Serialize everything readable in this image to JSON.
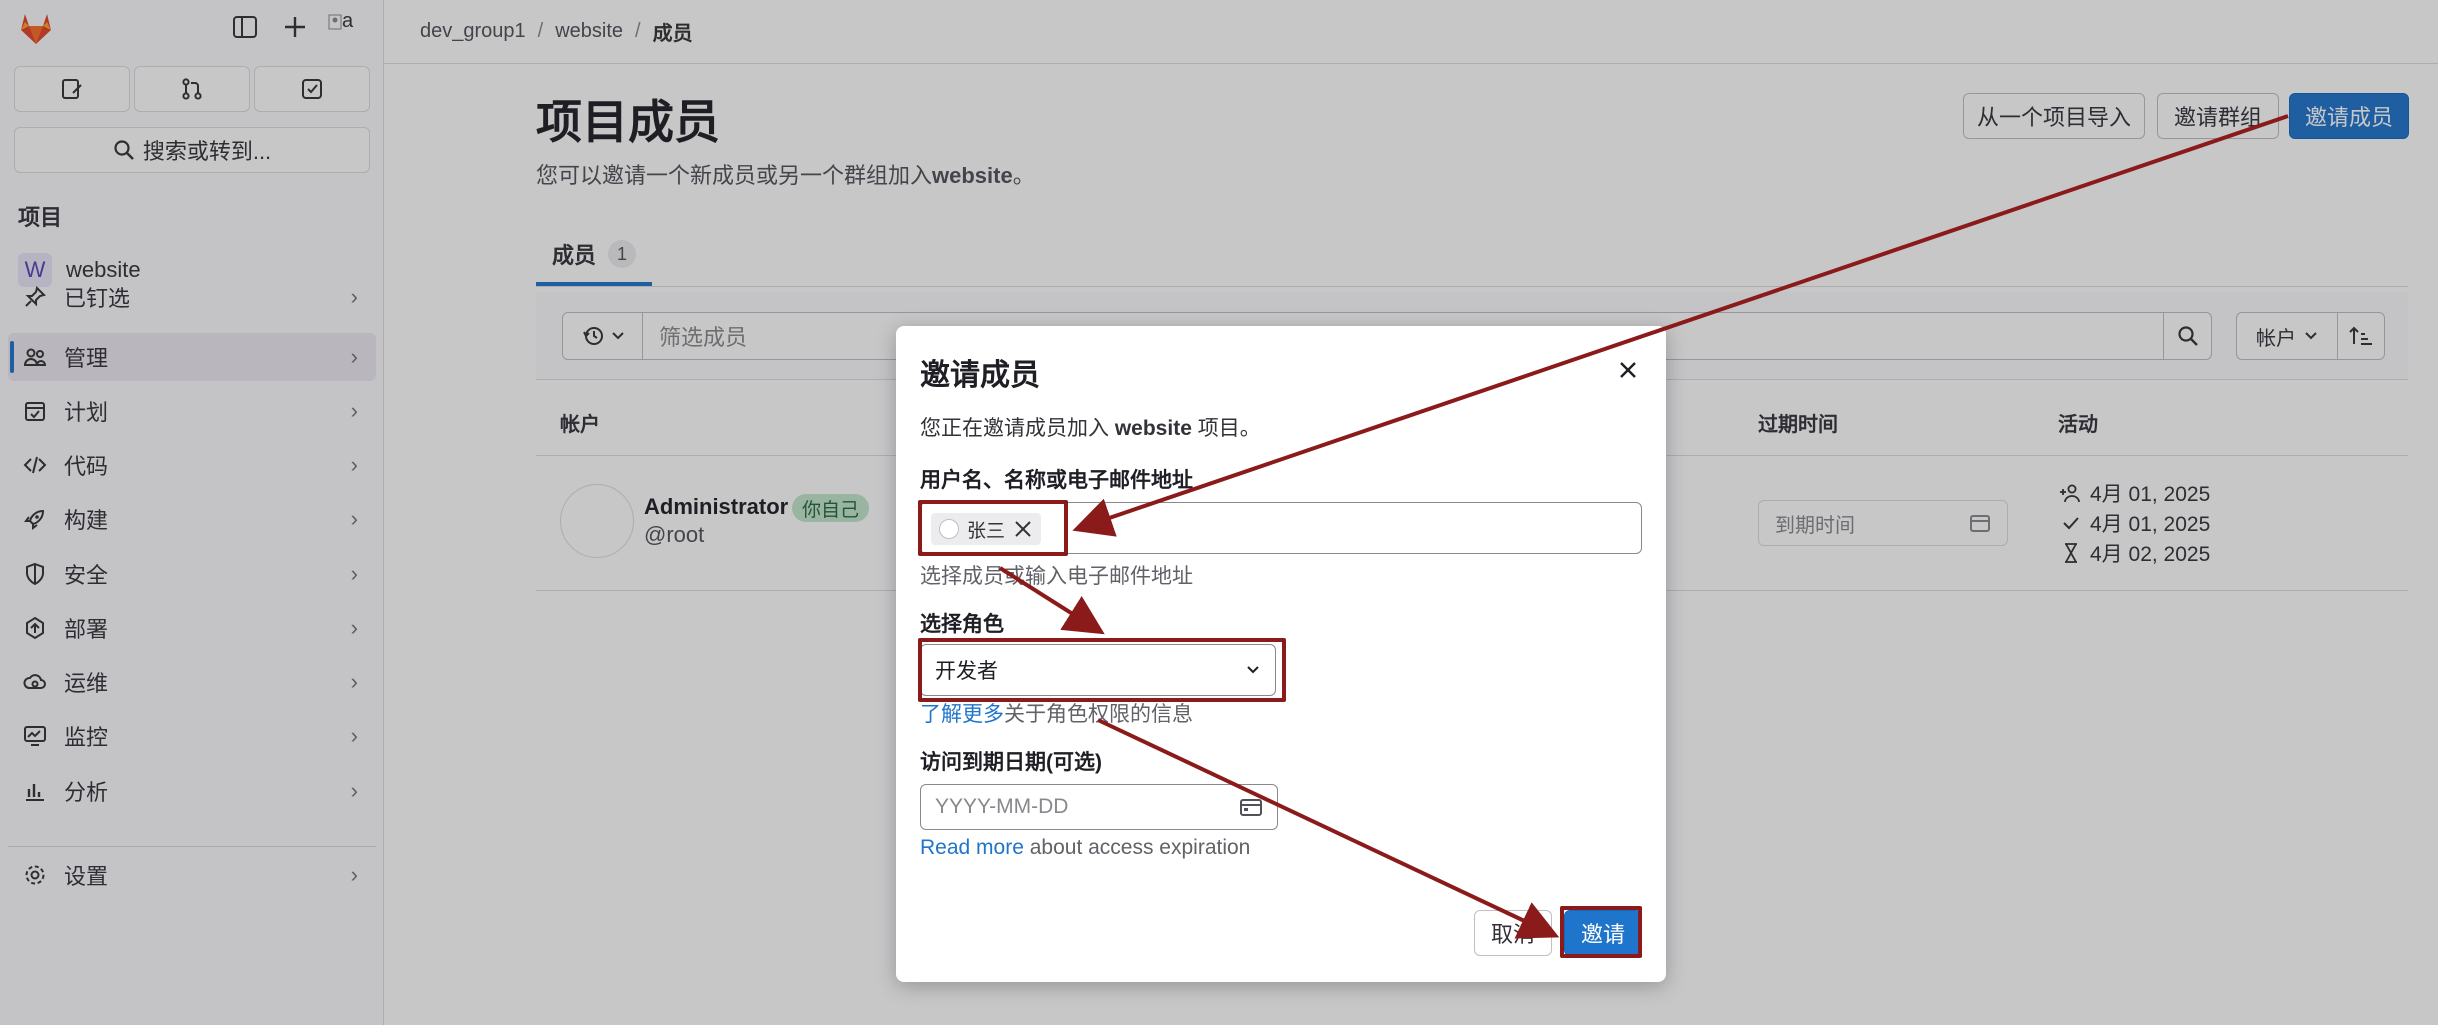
{
  "breadcrumb": {
    "group": "dev_group1",
    "project": "website",
    "current": "成员"
  },
  "sidebar": {
    "search_label": "搜索或转到...",
    "section_title": "项目",
    "project_letter": "W",
    "project_name": "website",
    "items": [
      {
        "label": "已钉选",
        "icon": "pin-icon"
      },
      {
        "label": "管理",
        "icon": "users-icon",
        "active": true
      },
      {
        "label": "计划",
        "icon": "calendar-icon"
      },
      {
        "label": "代码",
        "icon": "code-icon"
      },
      {
        "label": "构建",
        "icon": "rocket-icon"
      },
      {
        "label": "安全",
        "icon": "shield-icon"
      },
      {
        "label": "部署",
        "icon": "deploy-icon"
      },
      {
        "label": "运维",
        "icon": "cloud-gear-icon"
      },
      {
        "label": "监控",
        "icon": "monitor-icon"
      },
      {
        "label": "分析",
        "icon": "chart-icon"
      }
    ],
    "settings_label": "设置",
    "avatar_alt": "a"
  },
  "page": {
    "title": "项目成员",
    "subtitle_prefix": "您可以邀请一个新成员或另一个群组加入",
    "subtitle_project": "website",
    "subtitle_suffix": "。",
    "import_button": "从一个项目导入",
    "invite_group_button": "邀请群组",
    "invite_member_button": "邀请成员",
    "tab_label": "成员",
    "tab_count": "1",
    "filter_placeholder": "筛选成员",
    "sort_label": "帐户",
    "columns": {
      "account": "帐户",
      "expiry": "过期时间",
      "activity": "活动"
    }
  },
  "member": {
    "name": "Administrator",
    "self_badge": "你自己",
    "handle": "@root",
    "expiry_placeholder": "到期时间",
    "activity": [
      "4月 01, 2025",
      "4月 01, 2025",
      "4月 02, 2025"
    ]
  },
  "modal": {
    "title": "邀请成员",
    "intro_prefix": "您正在邀请成员加入 ",
    "intro_project": "website",
    "intro_suffix": " 项目。",
    "user_label": "用户名、名称或电子邮件地址",
    "token": "张三",
    "user_help": "选择成员或输入电子邮件地址",
    "role_label": "选择角色",
    "role_value": "开发者",
    "role_link": "了解更多",
    "role_link_suffix": "关于角色权限的信息",
    "date_label": "访问到期日期(可选)",
    "date_placeholder": "YYYY-MM-DD",
    "date_link": "Read more",
    "date_link_suffix": " about access expiration",
    "cancel": "取消",
    "invite": "邀请"
  },
  "colors": {
    "accent": "#1f75cb",
    "annotation": "#8b1a1a"
  }
}
